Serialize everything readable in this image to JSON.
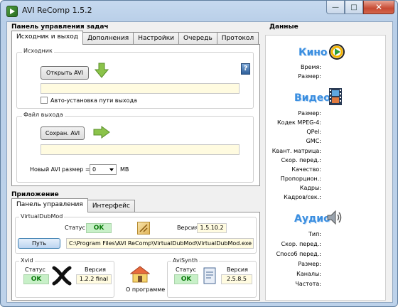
{
  "window": {
    "title": "AVI ReComp  1.5.2",
    "min": "—",
    "max": "□",
    "close": "✕"
  },
  "tasks": {
    "title": "Панель управления задач",
    "tabs": [
      "Исходник и выход",
      "Дополнения",
      "Настройки",
      "Очередь",
      "Протокол"
    ],
    "source": {
      "group": "Исходник",
      "open_btn": "Открыть AVI",
      "path": "",
      "auto_label": "Авто-установка пути выхода"
    },
    "output": {
      "group": "Файл выхода",
      "save_btn": "Сохран. AVI",
      "path": "",
      "size_label": "Новый AVI размер =",
      "size_value": "0",
      "size_unit": "MB"
    }
  },
  "app": {
    "title": "Приложение",
    "tabs": [
      "Панель управления",
      "Интерфейс"
    ],
    "vdm": {
      "group": "VirtualDubMod",
      "status_label": "Статус",
      "status_value": "OK",
      "version_label": "Версия",
      "version_value": "1.5.10.2",
      "path_btn": "Путь",
      "path": "C:\\Program Files\\AVI ReComp\\VirtualDubMod\\VirtualDubMod.exe"
    },
    "xvid": {
      "group": "Xvid",
      "status_label": "Статус",
      "status_value": "OK",
      "version_label": "Версия",
      "version_value": "1.2.2 final"
    },
    "about_label": "О программе",
    "avisynth": {
      "group": "AviSynth",
      "status_label": "Статус",
      "status_value": "OK",
      "version_label": "Версия",
      "version_value": "2.5.8.5"
    }
  },
  "data": {
    "title": "Данные",
    "movie": {
      "head": "Кино",
      "fields": [
        "Время:",
        "Размер:"
      ]
    },
    "video": {
      "head": "Видео",
      "fields": [
        "Размер:",
        "Кодек MPEG-4:",
        "QPel:",
        "GMC:",
        "Квант. матрица:",
        "Скор. перед.:",
        "Качество:",
        "Пропорцион.:",
        "Кадры:",
        "Кадров/сек.:"
      ]
    },
    "audio": {
      "head": "Аудио",
      "fields": [
        "Тип:",
        "Скор. перед.:",
        "Способ перед.:",
        "Размер:",
        "Каналы:",
        "Частота:"
      ]
    }
  },
  "colors": {
    "accent": "#3a8ee0",
    "ok_bg": "#c8f0c8",
    "field_bg": "#fffbe0"
  }
}
